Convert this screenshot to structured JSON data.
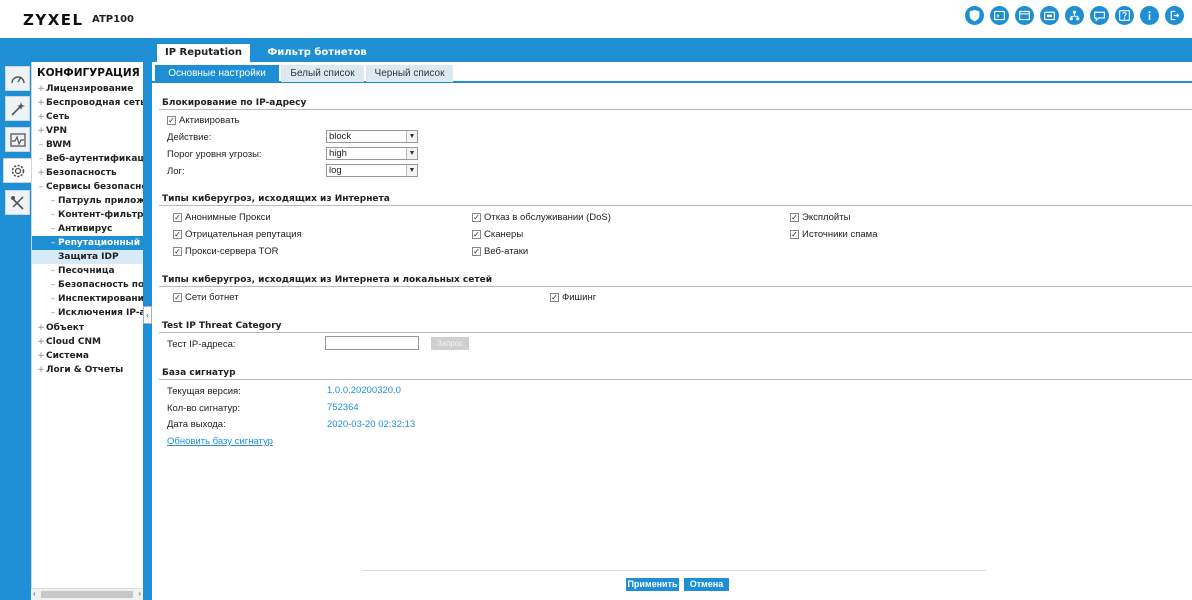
{
  "header": {
    "logo": "ZYXEL",
    "model": "ATP100",
    "icons": [
      "shield-icon",
      "terminal-icon",
      "console-icon",
      "cloud-icon",
      "network-icon",
      "chat-icon",
      "help-icon",
      "info-icon",
      "logout-icon"
    ]
  },
  "nav": {
    "title": "КОНФИГУРАЦИЯ",
    "items": [
      {
        "mark": "+",
        "label": "Лицензирование"
      },
      {
        "mark": "+",
        "label": "Беспроводная сеть"
      },
      {
        "mark": "+",
        "label": "Сеть"
      },
      {
        "mark": "+",
        "label": "VPN"
      },
      {
        "mark": "–",
        "label": "BWM"
      },
      {
        "mark": "–",
        "label": "Веб-аутентификация"
      },
      {
        "mark": "+",
        "label": "Безопасность"
      },
      {
        "mark": "–",
        "label": "Сервисы безопасности"
      },
      {
        "mark": "–",
        "label": "Патруль приложений"
      },
      {
        "mark": "–",
        "label": "Контент-фильтр"
      },
      {
        "mark": "–",
        "label": "Антивирус"
      },
      {
        "mark": "–",
        "label": "Репутационный фильтр"
      },
      {
        "mark": "",
        "label": "Защита IDP"
      },
      {
        "mark": "–",
        "label": "Песочница"
      },
      {
        "mark": "–",
        "label": "Безопасность почты"
      },
      {
        "mark": "–",
        "label": "Инспектирование SSL"
      },
      {
        "mark": "–",
        "label": "Исключения IP-адресов"
      },
      {
        "mark": "+",
        "label": "Объект"
      },
      {
        "mark": "+",
        "label": "Cloud CNM"
      },
      {
        "mark": "+",
        "label": "Система"
      },
      {
        "mark": "+",
        "label": "Логи & Отчеты"
      }
    ]
  },
  "tabs": {
    "ip_reputation": "IP Reputation",
    "botnet_filter": "Фильтр ботнетов"
  },
  "subtabs": {
    "basic": "Основные настройки",
    "whitelist": "Белый список",
    "blacklist": "Черный список"
  },
  "blocking": {
    "title": "Блокирование по IP-адресу",
    "activate": "Активировать",
    "action_label": "Действие:",
    "action_value": "block",
    "threat_label": "Порог уровня угрозы:",
    "threat_value": "high",
    "log_label": "Лог:",
    "log_value": "log"
  },
  "internet_threats": {
    "title": "Типы киберугроз, исходящих из Интернета",
    "items": [
      "Анонимные Прокси",
      "Отрицательная репутация",
      "Прокси-сервера TOR",
      "Отказ в обслуживании (DoS)",
      "Сканеры",
      "Веб-атаки",
      "Эксплойты",
      "Источники спама"
    ]
  },
  "local_threats": {
    "title": "Типы киберугроз, исходящих из Интернета и локальных сетей",
    "items": [
      "Сети ботнет",
      "Фишинг"
    ]
  },
  "test": {
    "title": "Test IP Threat Category",
    "label": "Тест IP-адреса:",
    "input_value": "",
    "button": "Запрос"
  },
  "signatures": {
    "title": "База сигнатур",
    "version_label": "Текущая версия:",
    "version_value": "1.0.0.20200320.0",
    "count_label": "Кол-во сигнатур:",
    "count_value": "752364",
    "date_label": "Дата выхода:",
    "date_value": "2020-03-20 02:32:13",
    "update_link": "Обновить базу сигнатур"
  },
  "footer": {
    "apply": "Применить",
    "cancel": "Отмена"
  },
  "colors": {
    "accent": "#1e8fd5"
  }
}
